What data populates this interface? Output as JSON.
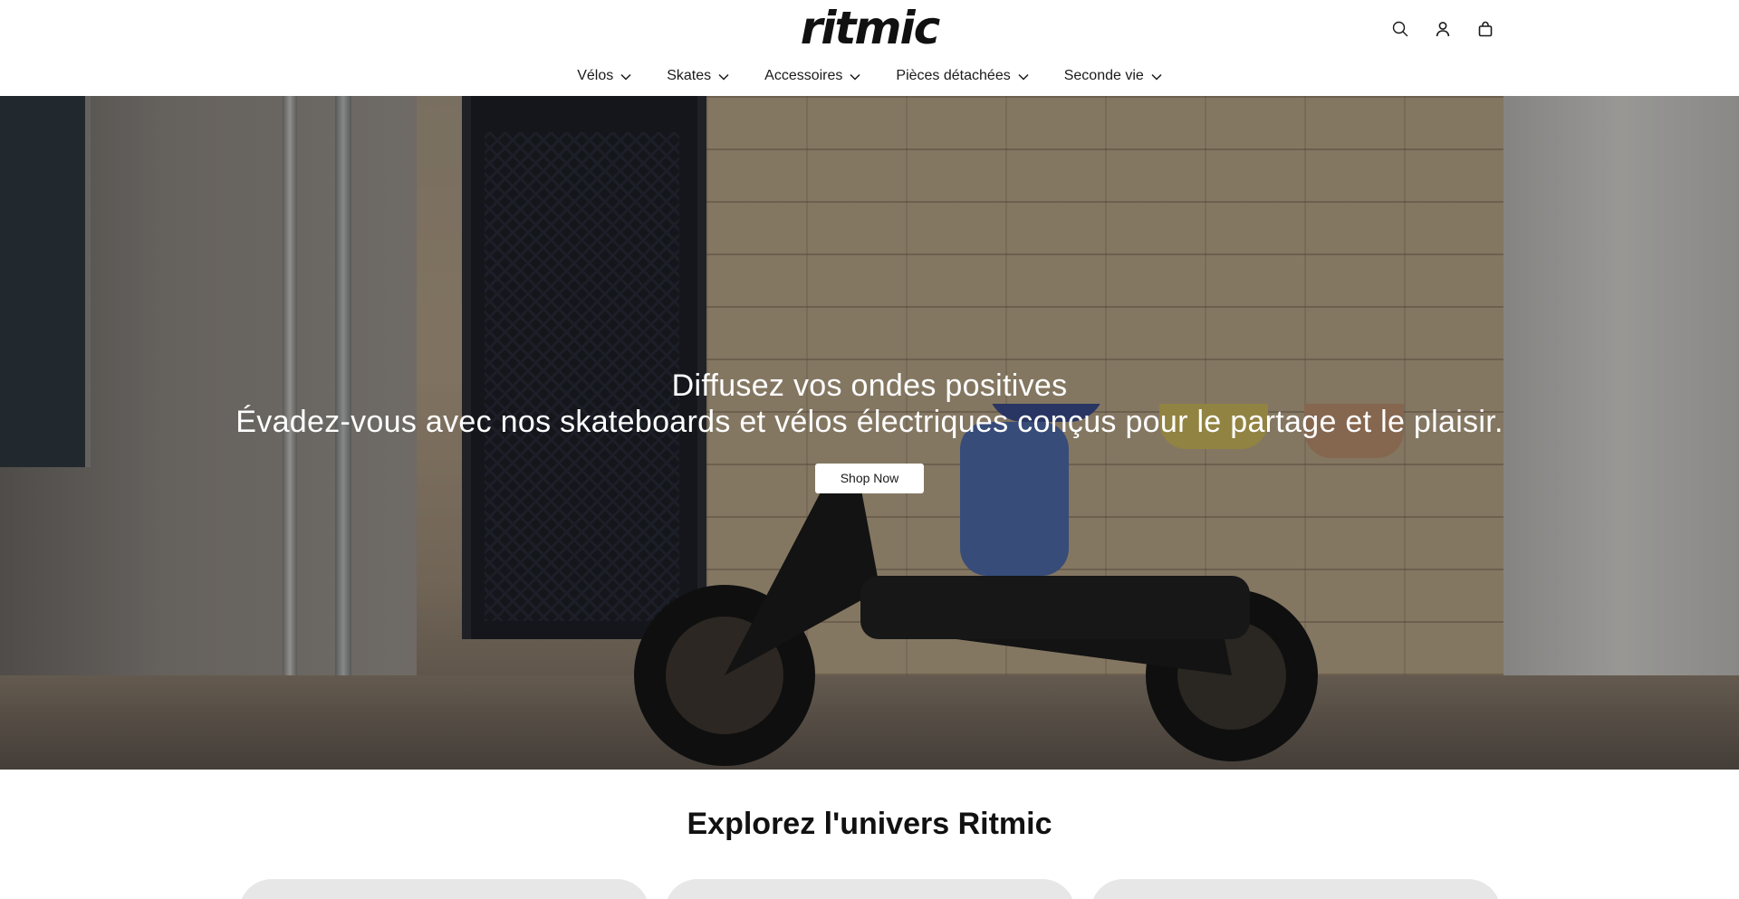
{
  "header": {
    "logo_text": "ritmic",
    "icons": [
      "search-icon",
      "account-icon",
      "cart-icon"
    ]
  },
  "nav": {
    "items": [
      {
        "label": "Vélos"
      },
      {
        "label": "Skates"
      },
      {
        "label": "Accessoires"
      },
      {
        "label": "Pièces détachées"
      },
      {
        "label": "Seconde vie"
      }
    ]
  },
  "hero": {
    "title": "Diffusez vos ondes positives",
    "subtitle": "Évadez-vous avec nos skateboards et vélos électriques conçus pour le partage et le plaisir.",
    "cta_label": "Shop Now"
  },
  "explore": {
    "title": "Explorez l'univers Ritmic"
  },
  "colors": {
    "text": "#1a1a1a",
    "background": "#ffffff",
    "card": "#e7e7e7"
  }
}
